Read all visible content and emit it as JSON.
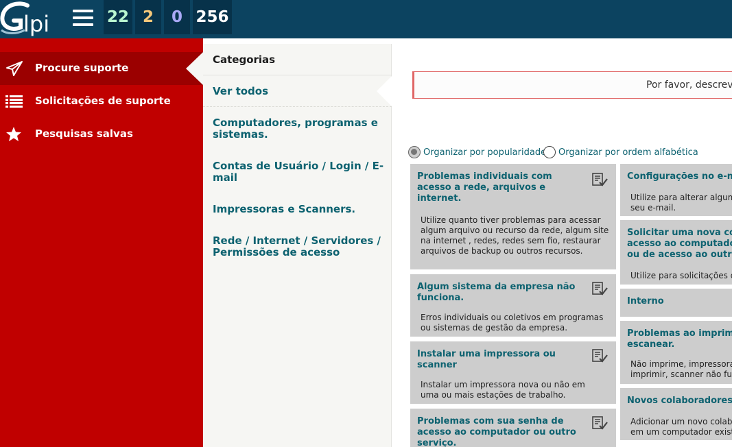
{
  "header": {
    "logo_text": "Glpi",
    "counters": [
      "22",
      "2",
      "0",
      "256"
    ]
  },
  "sidebar": {
    "items": [
      {
        "label": "Procure suporte",
        "icon": "paper-plane-icon",
        "active": true
      },
      {
        "label": "Solicitações de suporte",
        "icon": "list-icon",
        "active": false
      },
      {
        "label": "Pesquisas salvas",
        "icon": "star-icon",
        "active": false
      }
    ]
  },
  "categories": {
    "title": "Categorias",
    "items": [
      {
        "label": "Ver todos",
        "active": true
      },
      {
        "label": "Computadores, programas e sistemas."
      },
      {
        "label": "Contas de Usuário / Login / E-mail"
      },
      {
        "label": "Impressoras e Scanners."
      },
      {
        "label": "Rede / Internet / Servidores / Permissões de acesso"
      }
    ]
  },
  "search": {
    "placeholder": "Por favor, descreva seu problema"
  },
  "sort": {
    "popularity": "Organizar por popularidade",
    "alphabetical": "Organizar por ordem alfabética",
    "selected": "popularity"
  },
  "forms_left": [
    {
      "title": "Problemas individuais com acesso a rede, arquivos e internet.",
      "desc": "Utilize quanto tiver problemas para acessar algum arquivo ou recurso da rede, algum site na internet , redes, redes sem fio, restaurar arquivos de backup ou outros recursos.",
      "icon": "form-check-icon"
    },
    {
      "title": "Algum sistema da empresa não funciona.",
      "desc": "Erros individuais ou coletivos em programas ou sistemas de gestão da empresa.",
      "icon": "form-check-icon"
    },
    {
      "title": "Instalar uma impressora ou scanner",
      "desc": "Instalar um impressora nova ou não em uma ou mais estações de trabalho.",
      "icon": "form-check-icon"
    },
    {
      "title": "Problemas com sua senha de acesso ao computador ou outro serviço.",
      "desc": "",
      "icon": "form-check-icon"
    }
  ],
  "forms_right": [
    {
      "title": "Configurações no e-m",
      "desc": "Utilize para alterar algum seu e-mail."
    },
    {
      "title": "Solicitar uma nova co acesso ao computado ou de acesso ao outr",
      "desc": "Utilize para solicitações d"
    },
    {
      "title": "Interno",
      "desc": ""
    },
    {
      "title": "Problemas ao imprim escanear.",
      "desc": "Não imprime, impressora imprimir, scanner não fu"
    },
    {
      "title": "Novos colaboradores",
      "desc": "Adicionar um novo colab em um computador exist"
    }
  ],
  "colors": {
    "header_bg": "#0c4360",
    "sidebar_bg": "#c00000",
    "sidebar_active": "#9b0000",
    "link": "#0d6270",
    "card_bg": "#cdcdcd"
  }
}
